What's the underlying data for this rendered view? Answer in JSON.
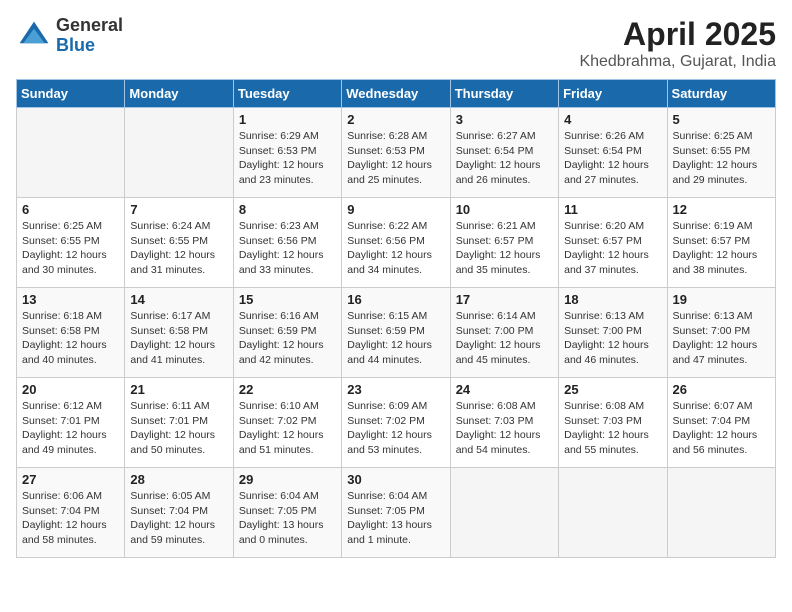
{
  "header": {
    "logo_general": "General",
    "logo_blue": "Blue",
    "title": "April 2025",
    "location": "Khedbrahma, Gujarat, India"
  },
  "weekdays": [
    "Sunday",
    "Monday",
    "Tuesday",
    "Wednesday",
    "Thursday",
    "Friday",
    "Saturday"
  ],
  "weeks": [
    [
      {
        "day": null,
        "sunrise": null,
        "sunset": null,
        "daylight": null
      },
      {
        "day": null,
        "sunrise": null,
        "sunset": null,
        "daylight": null
      },
      {
        "day": "1",
        "sunrise": "Sunrise: 6:29 AM",
        "sunset": "Sunset: 6:53 PM",
        "daylight": "Daylight: 12 hours and 23 minutes."
      },
      {
        "day": "2",
        "sunrise": "Sunrise: 6:28 AM",
        "sunset": "Sunset: 6:53 PM",
        "daylight": "Daylight: 12 hours and 25 minutes."
      },
      {
        "day": "3",
        "sunrise": "Sunrise: 6:27 AM",
        "sunset": "Sunset: 6:54 PM",
        "daylight": "Daylight: 12 hours and 26 minutes."
      },
      {
        "day": "4",
        "sunrise": "Sunrise: 6:26 AM",
        "sunset": "Sunset: 6:54 PM",
        "daylight": "Daylight: 12 hours and 27 minutes."
      },
      {
        "day": "5",
        "sunrise": "Sunrise: 6:25 AM",
        "sunset": "Sunset: 6:55 PM",
        "daylight": "Daylight: 12 hours and 29 minutes."
      }
    ],
    [
      {
        "day": "6",
        "sunrise": "Sunrise: 6:25 AM",
        "sunset": "Sunset: 6:55 PM",
        "daylight": "Daylight: 12 hours and 30 minutes."
      },
      {
        "day": "7",
        "sunrise": "Sunrise: 6:24 AM",
        "sunset": "Sunset: 6:55 PM",
        "daylight": "Daylight: 12 hours and 31 minutes."
      },
      {
        "day": "8",
        "sunrise": "Sunrise: 6:23 AM",
        "sunset": "Sunset: 6:56 PM",
        "daylight": "Daylight: 12 hours and 33 minutes."
      },
      {
        "day": "9",
        "sunrise": "Sunrise: 6:22 AM",
        "sunset": "Sunset: 6:56 PM",
        "daylight": "Daylight: 12 hours and 34 minutes."
      },
      {
        "day": "10",
        "sunrise": "Sunrise: 6:21 AM",
        "sunset": "Sunset: 6:57 PM",
        "daylight": "Daylight: 12 hours and 35 minutes."
      },
      {
        "day": "11",
        "sunrise": "Sunrise: 6:20 AM",
        "sunset": "Sunset: 6:57 PM",
        "daylight": "Daylight: 12 hours and 37 minutes."
      },
      {
        "day": "12",
        "sunrise": "Sunrise: 6:19 AM",
        "sunset": "Sunset: 6:57 PM",
        "daylight": "Daylight: 12 hours and 38 minutes."
      }
    ],
    [
      {
        "day": "13",
        "sunrise": "Sunrise: 6:18 AM",
        "sunset": "Sunset: 6:58 PM",
        "daylight": "Daylight: 12 hours and 40 minutes."
      },
      {
        "day": "14",
        "sunrise": "Sunrise: 6:17 AM",
        "sunset": "Sunset: 6:58 PM",
        "daylight": "Daylight: 12 hours and 41 minutes."
      },
      {
        "day": "15",
        "sunrise": "Sunrise: 6:16 AM",
        "sunset": "Sunset: 6:59 PM",
        "daylight": "Daylight: 12 hours and 42 minutes."
      },
      {
        "day": "16",
        "sunrise": "Sunrise: 6:15 AM",
        "sunset": "Sunset: 6:59 PM",
        "daylight": "Daylight: 12 hours and 44 minutes."
      },
      {
        "day": "17",
        "sunrise": "Sunrise: 6:14 AM",
        "sunset": "Sunset: 7:00 PM",
        "daylight": "Daylight: 12 hours and 45 minutes."
      },
      {
        "day": "18",
        "sunrise": "Sunrise: 6:13 AM",
        "sunset": "Sunset: 7:00 PM",
        "daylight": "Daylight: 12 hours and 46 minutes."
      },
      {
        "day": "19",
        "sunrise": "Sunrise: 6:13 AM",
        "sunset": "Sunset: 7:00 PM",
        "daylight": "Daylight: 12 hours and 47 minutes."
      }
    ],
    [
      {
        "day": "20",
        "sunrise": "Sunrise: 6:12 AM",
        "sunset": "Sunset: 7:01 PM",
        "daylight": "Daylight: 12 hours and 49 minutes."
      },
      {
        "day": "21",
        "sunrise": "Sunrise: 6:11 AM",
        "sunset": "Sunset: 7:01 PM",
        "daylight": "Daylight: 12 hours and 50 minutes."
      },
      {
        "day": "22",
        "sunrise": "Sunrise: 6:10 AM",
        "sunset": "Sunset: 7:02 PM",
        "daylight": "Daylight: 12 hours and 51 minutes."
      },
      {
        "day": "23",
        "sunrise": "Sunrise: 6:09 AM",
        "sunset": "Sunset: 7:02 PM",
        "daylight": "Daylight: 12 hours and 53 minutes."
      },
      {
        "day": "24",
        "sunrise": "Sunrise: 6:08 AM",
        "sunset": "Sunset: 7:03 PM",
        "daylight": "Daylight: 12 hours and 54 minutes."
      },
      {
        "day": "25",
        "sunrise": "Sunrise: 6:08 AM",
        "sunset": "Sunset: 7:03 PM",
        "daylight": "Daylight: 12 hours and 55 minutes."
      },
      {
        "day": "26",
        "sunrise": "Sunrise: 6:07 AM",
        "sunset": "Sunset: 7:04 PM",
        "daylight": "Daylight: 12 hours and 56 minutes."
      }
    ],
    [
      {
        "day": "27",
        "sunrise": "Sunrise: 6:06 AM",
        "sunset": "Sunset: 7:04 PM",
        "daylight": "Daylight: 12 hours and 58 minutes."
      },
      {
        "day": "28",
        "sunrise": "Sunrise: 6:05 AM",
        "sunset": "Sunset: 7:04 PM",
        "daylight": "Daylight: 12 hours and 59 minutes."
      },
      {
        "day": "29",
        "sunrise": "Sunrise: 6:04 AM",
        "sunset": "Sunset: 7:05 PM",
        "daylight": "Daylight: 13 hours and 0 minutes."
      },
      {
        "day": "30",
        "sunrise": "Sunrise: 6:04 AM",
        "sunset": "Sunset: 7:05 PM",
        "daylight": "Daylight: 13 hours and 1 minute."
      },
      {
        "day": null,
        "sunrise": null,
        "sunset": null,
        "daylight": null
      },
      {
        "day": null,
        "sunrise": null,
        "sunset": null,
        "daylight": null
      },
      {
        "day": null,
        "sunrise": null,
        "sunset": null,
        "daylight": null
      }
    ]
  ]
}
